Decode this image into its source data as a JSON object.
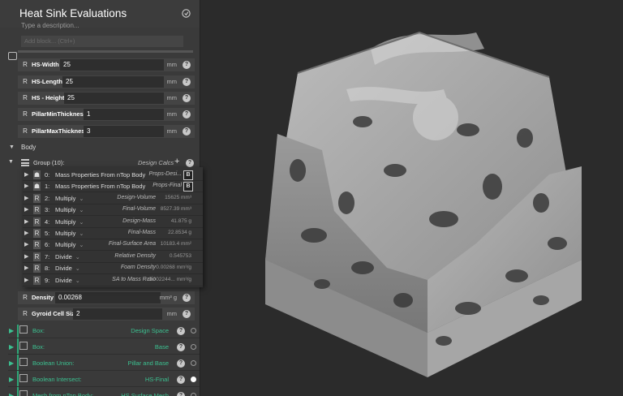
{
  "panel": {
    "title": "Heat Sink Evaluations",
    "description_placeholder": "Type a description...",
    "add_block_placeholder": "Add block... (Ctrl+)",
    "variables": [
      {
        "badge": "R",
        "label": "HS-Width",
        "value": "25",
        "unit": "mm"
      },
      {
        "badge": "R",
        "label": "HS-Length",
        "value": "25",
        "unit": "mm"
      },
      {
        "badge": "R",
        "label": "HS - Height",
        "value": "25",
        "unit": "mm"
      },
      {
        "badge": "R",
        "label": "PillarMinThickness",
        "value": "1",
        "unit": "mm"
      },
      {
        "badge": "R",
        "label": "PillarMaxThickness",
        "value": "3",
        "unit": "mm"
      }
    ],
    "section_label": "Body",
    "group": {
      "label": "Group (10):",
      "name": "Design Calcs",
      "rows": [
        {
          "index": "0:",
          "icon": "☗",
          "name": "Mass Properties From nTop Body",
          "alias": "Props-Desi...",
          "value": "",
          "b": "B"
        },
        {
          "index": "1:",
          "icon": "☗",
          "name": "Mass Properties From nTop Body",
          "alias": "Props-Final",
          "value": "",
          "b": "B"
        },
        {
          "index": "2:",
          "icon": "R",
          "name": "Multiply",
          "alias": "Design-Volume",
          "value": "15625 mm³",
          "b": ""
        },
        {
          "index": "3:",
          "icon": "R",
          "name": "Multiply",
          "alias": "Final-Volume",
          "value": "8527.39 mm³",
          "b": ""
        },
        {
          "index": "4:",
          "icon": "R",
          "name": "Multiply",
          "alias": "Design-Mass",
          "value": "41.875 g",
          "b": ""
        },
        {
          "index": "5:",
          "icon": "R",
          "name": "Multiply",
          "alias": "Final-Mass",
          "value": "22.8534 g",
          "b": ""
        },
        {
          "index": "6:",
          "icon": "R",
          "name": "Multiply",
          "alias": "Final-Surface Area",
          "value": "10183.4 mm²",
          "b": ""
        },
        {
          "index": "7:",
          "icon": "R",
          "name": "Divide",
          "alias": "Relative Density",
          "value": "0.545753",
          "b": ""
        },
        {
          "index": "8:",
          "icon": "R",
          "name": "Divide",
          "alias": "Foam Density",
          "value": "0.00268 mm³/g",
          "b": ""
        },
        {
          "index": "9:",
          "icon": "R",
          "name": "Divide",
          "alias": "SA to Mass Ratio",
          "value": "0.002244... mm³/g",
          "b": ""
        }
      ]
    },
    "after_vars": [
      {
        "badge": "R",
        "label": "Density",
        "value": "0.00268",
        "unit": "mm³ g"
      },
      {
        "badge": "R",
        "label": "Gyroid Cell Size",
        "value": "2",
        "unit": "mm"
      }
    ],
    "blocks": [
      {
        "label": "Box:",
        "value": "Design Space",
        "on": false
      },
      {
        "label": "Box:",
        "value": "Base",
        "on": false
      },
      {
        "label": "Boolean Union:",
        "value": "Pillar and Base",
        "on": false
      },
      {
        "label": "Boolean Intersect:",
        "value": "HS-Final",
        "on": true
      },
      {
        "label": "Mesh from nTop Body:",
        "value": "HS Surface Mesh",
        "on": false
      }
    ],
    "help_glyph": "?",
    "plus_glyph": "+"
  }
}
